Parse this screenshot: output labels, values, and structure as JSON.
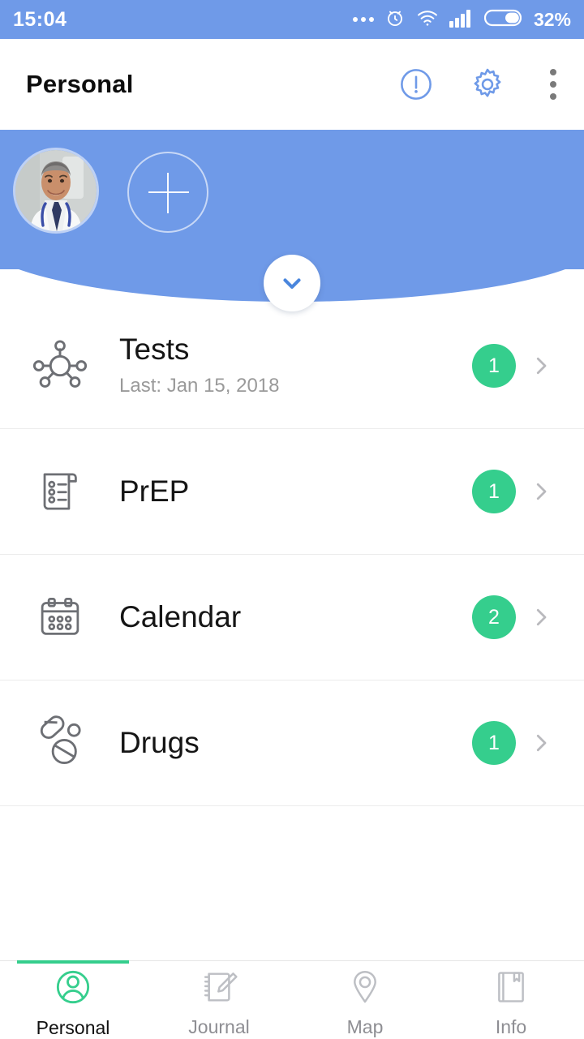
{
  "status_bar": {
    "time": "15:04",
    "battery_percent": "32%",
    "icons": [
      "more-dots-icon",
      "alarm-clock-icon",
      "wifi-icon",
      "cellular-signal-icon",
      "battery-icon"
    ],
    "background_color": "#6f9ae8",
    "text_color": "#ffffff"
  },
  "app_bar": {
    "title": "Personal",
    "actions": [
      {
        "name": "alert-info-icon",
        "label": "Alert"
      },
      {
        "name": "gear-icon",
        "label": "Settings"
      },
      {
        "name": "overflow-menu-icon",
        "label": "More options"
      }
    ],
    "accent_color": "#6f9ae8"
  },
  "profile_banner": {
    "background_color": "#6f9ae8",
    "avatar": {
      "name": "avatar",
      "alt": "Doctor profile photo"
    },
    "add_profile": {
      "name": "add-profile-button",
      "icon": "plus-icon"
    },
    "expand": {
      "name": "expand-button",
      "icon": "chevron-down-icon",
      "color": "#4a86dd"
    }
  },
  "menu_list": {
    "badge_color": "#35ce8d",
    "items": [
      {
        "icon": "molecule-icon",
        "title": "Tests",
        "subtitle": "Last: Jan 15, 2018",
        "badge": "1"
      },
      {
        "icon": "prescription-document-icon",
        "title": "PrEP",
        "subtitle": "",
        "badge": "1"
      },
      {
        "icon": "calendar-icon",
        "title": "Calendar",
        "subtitle": "",
        "badge": "2"
      },
      {
        "icon": "pills-icon",
        "title": "Drugs",
        "subtitle": "",
        "badge": "1"
      }
    ]
  },
  "bottom_nav": {
    "active_color": "#35ce8d",
    "inactive_color": "#8e8e93",
    "tabs": [
      {
        "icon": "person-circle-icon",
        "label": "Personal",
        "active": true
      },
      {
        "icon": "notebook-pencil-icon",
        "label": "Journal",
        "active": false
      },
      {
        "icon": "map-pin-icon",
        "label": "Map",
        "active": false
      },
      {
        "icon": "book-bookmark-icon",
        "label": "Info",
        "active": false
      }
    ]
  }
}
